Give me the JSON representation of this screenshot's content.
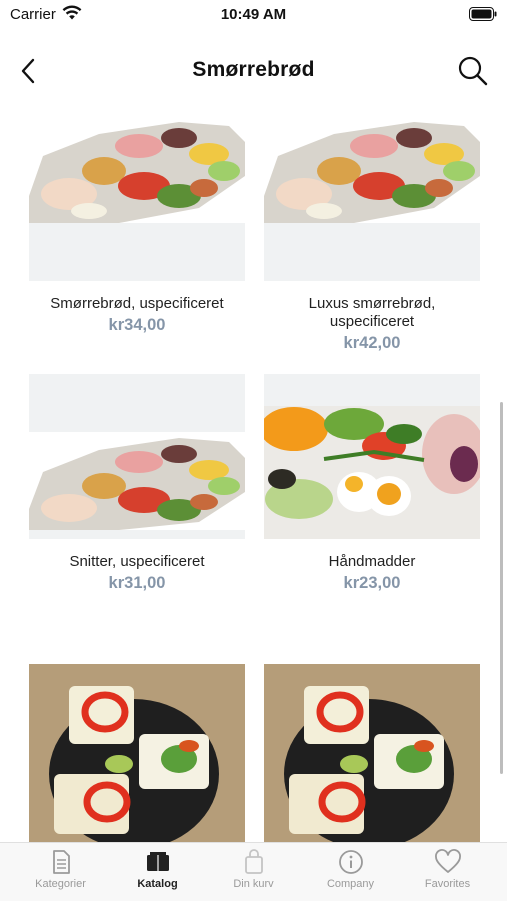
{
  "status_bar": {
    "carrier": "Carrier",
    "time": "10:49 AM"
  },
  "nav": {
    "title": "Smørrebrød",
    "back_icon": "chevron-left-icon",
    "search_icon": "search-icon"
  },
  "products": [
    {
      "name": "Smørrebrød, uspecificeret",
      "price": "kr34,00",
      "image": "platter"
    },
    {
      "name": "Luxus smørrebrød, uspecificeret",
      "price": "kr42,00",
      "image": "platter"
    },
    {
      "name": "Snitter, uspecificeret",
      "price": "kr31,00",
      "image": "platter"
    },
    {
      "name": "Håndmadder",
      "price": "kr23,00",
      "image": "egg-salad"
    },
    {
      "name": "",
      "price": "",
      "image": "bread-pepper"
    },
    {
      "name": "",
      "price": "",
      "image": "bread-pepper"
    }
  ],
  "tabs": [
    {
      "label": "Kategorier",
      "icon": "document-icon",
      "active": false
    },
    {
      "label": "Katalog",
      "icon": "catalog-icon",
      "active": true
    },
    {
      "label": "Din kurv",
      "icon": "bag-icon",
      "active": false
    },
    {
      "label": "Company",
      "icon": "info-icon",
      "active": false
    },
    {
      "label": "Favorites",
      "icon": "heart-icon",
      "active": false
    }
  ],
  "colors": {
    "price": "#8595a8",
    "tab_inactive": "#9a9a9a",
    "tab_active": "#222222",
    "thumb_bg": "#f0f2f3"
  }
}
